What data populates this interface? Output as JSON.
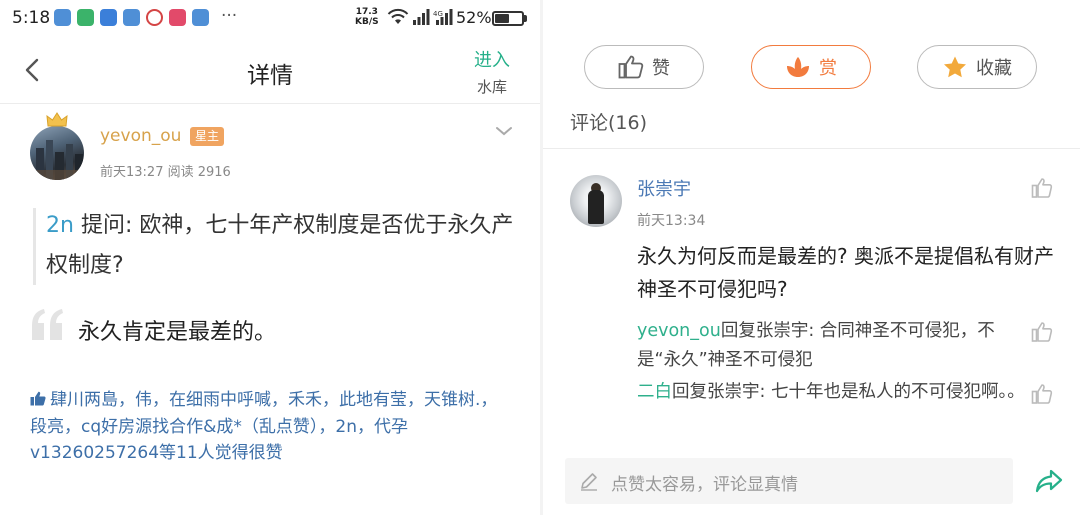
{
  "status_bar": {
    "time": "5:18",
    "app_icon_colors": [
      "#4f8fd6",
      "#3bb36a",
      "#3b7fd9",
      "#4f8fd6",
      "#d44545",
      "#e24a6a",
      "#4f8fd6"
    ],
    "more": "···",
    "net_speed_value": "17.3",
    "net_speed_unit": "KB/S",
    "battery_text": "52%",
    "battery_level": 0.52
  },
  "header": {
    "title": "详情",
    "enter_label": "进入",
    "enter_sub": "水库"
  },
  "post": {
    "author": "yevon_ou",
    "badge": "星主",
    "meta": "前天13:27  阅读 2916",
    "question_number": "2n",
    "question_text": " 提问: 欧神，七十年产权制度是否优于永久产权制度?",
    "answer": "永久肯定是最差的。",
    "likers": "肆川两島，伟，在细雨中呼喊，禾禾，此地有莹，天锥树.，段亮，cq好房源找合作&成*（乱点赞），2n，代孕v13260257264等11人觉得很赞"
  },
  "actions": {
    "like": "赞",
    "reward": "赏",
    "favorite": "收藏"
  },
  "comments": {
    "header": "评论(16)",
    "items": [
      {
        "name": "张崇宇",
        "time": "前天13:34",
        "text": "永久为何反而是最差的? 奥派不是提倡私有财产神圣不可侵犯吗?",
        "replies": [
          {
            "user": "yevon_ou",
            "action": "回复",
            "target": "张崇宇",
            "text": ": 合同神圣不可侵犯，不是“永久”神圣不可侵犯"
          },
          {
            "user": "二白",
            "action": "回复",
            "target": "张崇宇",
            "text": ": 七十年也是私人的不可侵犯啊。。"
          }
        ]
      }
    ]
  },
  "input": {
    "placeholder": "点赞太容易，评论显真情"
  },
  "colors": {
    "accent_green": "#26b08a",
    "link_blue": "#3d6fa8",
    "reward_orange": "#f27b3e",
    "author_gold": "#d7a24b"
  }
}
